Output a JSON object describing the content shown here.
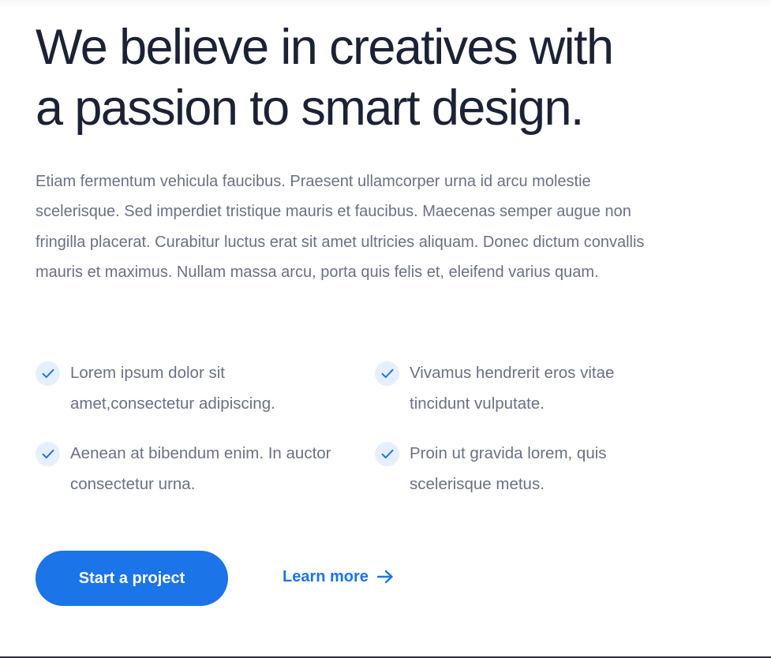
{
  "headline": {
    "line1": "We believe in creatives with",
    "line2": "a passion to smart design."
  },
  "intro": "Etiam fermentum vehicula faucibus. Praesent ullamcorper urna id arcu molestie scelerisque. Sed imperdiet tristique mauris et faucibus. Maecenas semper augue non fringilla placerat. Curabitur luctus erat sit amet ultricies aliquam. Donec dictum convallis mauris et maximus. Nullam massa arcu, porta quis felis et, eleifend varius quam.",
  "features": [
    {
      "text": "Lorem ipsum dolor sit amet,consectetur adipiscing.",
      "icon": "check-icon"
    },
    {
      "text": "Vivamus hendrerit eros vitae tincidunt vulputate.",
      "icon": "check-icon"
    },
    {
      "text": "Aenean at bibendum enim. In auctor consectetur urna.",
      "icon": "check-icon"
    },
    {
      "text": "Proin ut gravida lorem, quis scelerisque metus.",
      "icon": "check-icon"
    }
  ],
  "actions": {
    "primary_label": "Start a project",
    "secondary_label": "Learn more",
    "secondary_icon": "arrow-right-icon"
  },
  "colors": {
    "accent": "#1b74e8",
    "heading": "#1c2235",
    "body_text": "#6b7182",
    "check_bg": "#e5efff"
  }
}
